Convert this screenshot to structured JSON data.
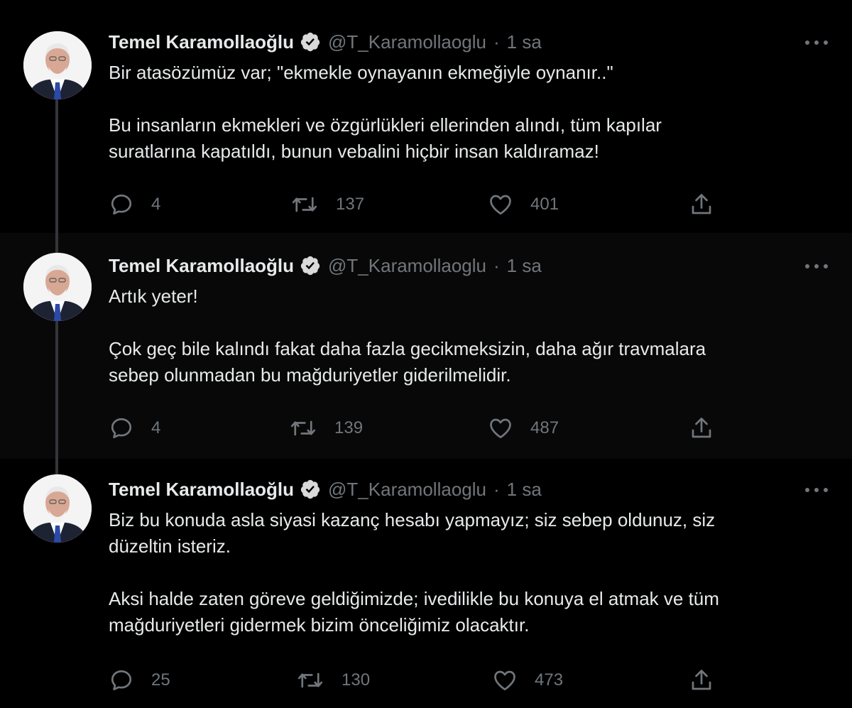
{
  "tweets": [
    {
      "name": "Temel Karamollaoğlu",
      "handle": "@T_Karamollaoglu",
      "separator": "·",
      "time": "1 sa",
      "paragraphs": [
        [
          "Bir atasözümüz var; \"ekmekle oynayanın ekmeğiyle oynanır..\""
        ],
        [
          "Bu insanların ekmekleri ve özgürlükleri ellerinden alındı, tüm kapılar",
          "suratlarına kapatıldı, bunun vebalini hiçbir insan kaldıramaz!"
        ]
      ],
      "replies": "4",
      "retweets": "137",
      "likes": "401"
    },
    {
      "name": "Temel Karamollaoğlu",
      "handle": "@T_Karamollaoglu",
      "separator": "·",
      "time": "1 sa",
      "paragraphs": [
        [
          "Artık yeter!"
        ],
        [
          "Çok geç bile kalındı fakat daha fazla gecikmeksizin, daha ağır travmalara",
          "sebep olunmadan bu mağduriyetler giderilmelidir."
        ]
      ],
      "replies": "4",
      "retweets": "139",
      "likes": "487"
    },
    {
      "name": "Temel Karamollaoğlu",
      "handle": "@T_Karamollaoglu",
      "separator": "·",
      "time": "1 sa",
      "paragraphs": [
        [
          "Biz bu konuda asla siyasi kazanç hesabı yapmayız; siz sebep oldunuz, siz",
          "düzeltin isteriz."
        ],
        [
          "Aksi halde zaten göreve geldiğimizde; ivedilikle bu konuya el atmak ve tüm",
          "mağduriyetleri gidermek bizim önceliğimiz olacaktır."
        ]
      ],
      "replies": "25",
      "retweets": "130",
      "likes": "473"
    }
  ],
  "icons": {
    "avatar": "avatar",
    "verified": "verified-badge-icon",
    "more": "more-options-icon",
    "reply": "reply-icon",
    "retweet": "retweet-icon",
    "like": "like-icon",
    "share": "share-icon"
  },
  "colors": {
    "background": "#000000",
    "hover_background": "#080808",
    "text": "#e7e9ea",
    "secondary_text": "#71767b",
    "thread_line": "#333639"
  }
}
